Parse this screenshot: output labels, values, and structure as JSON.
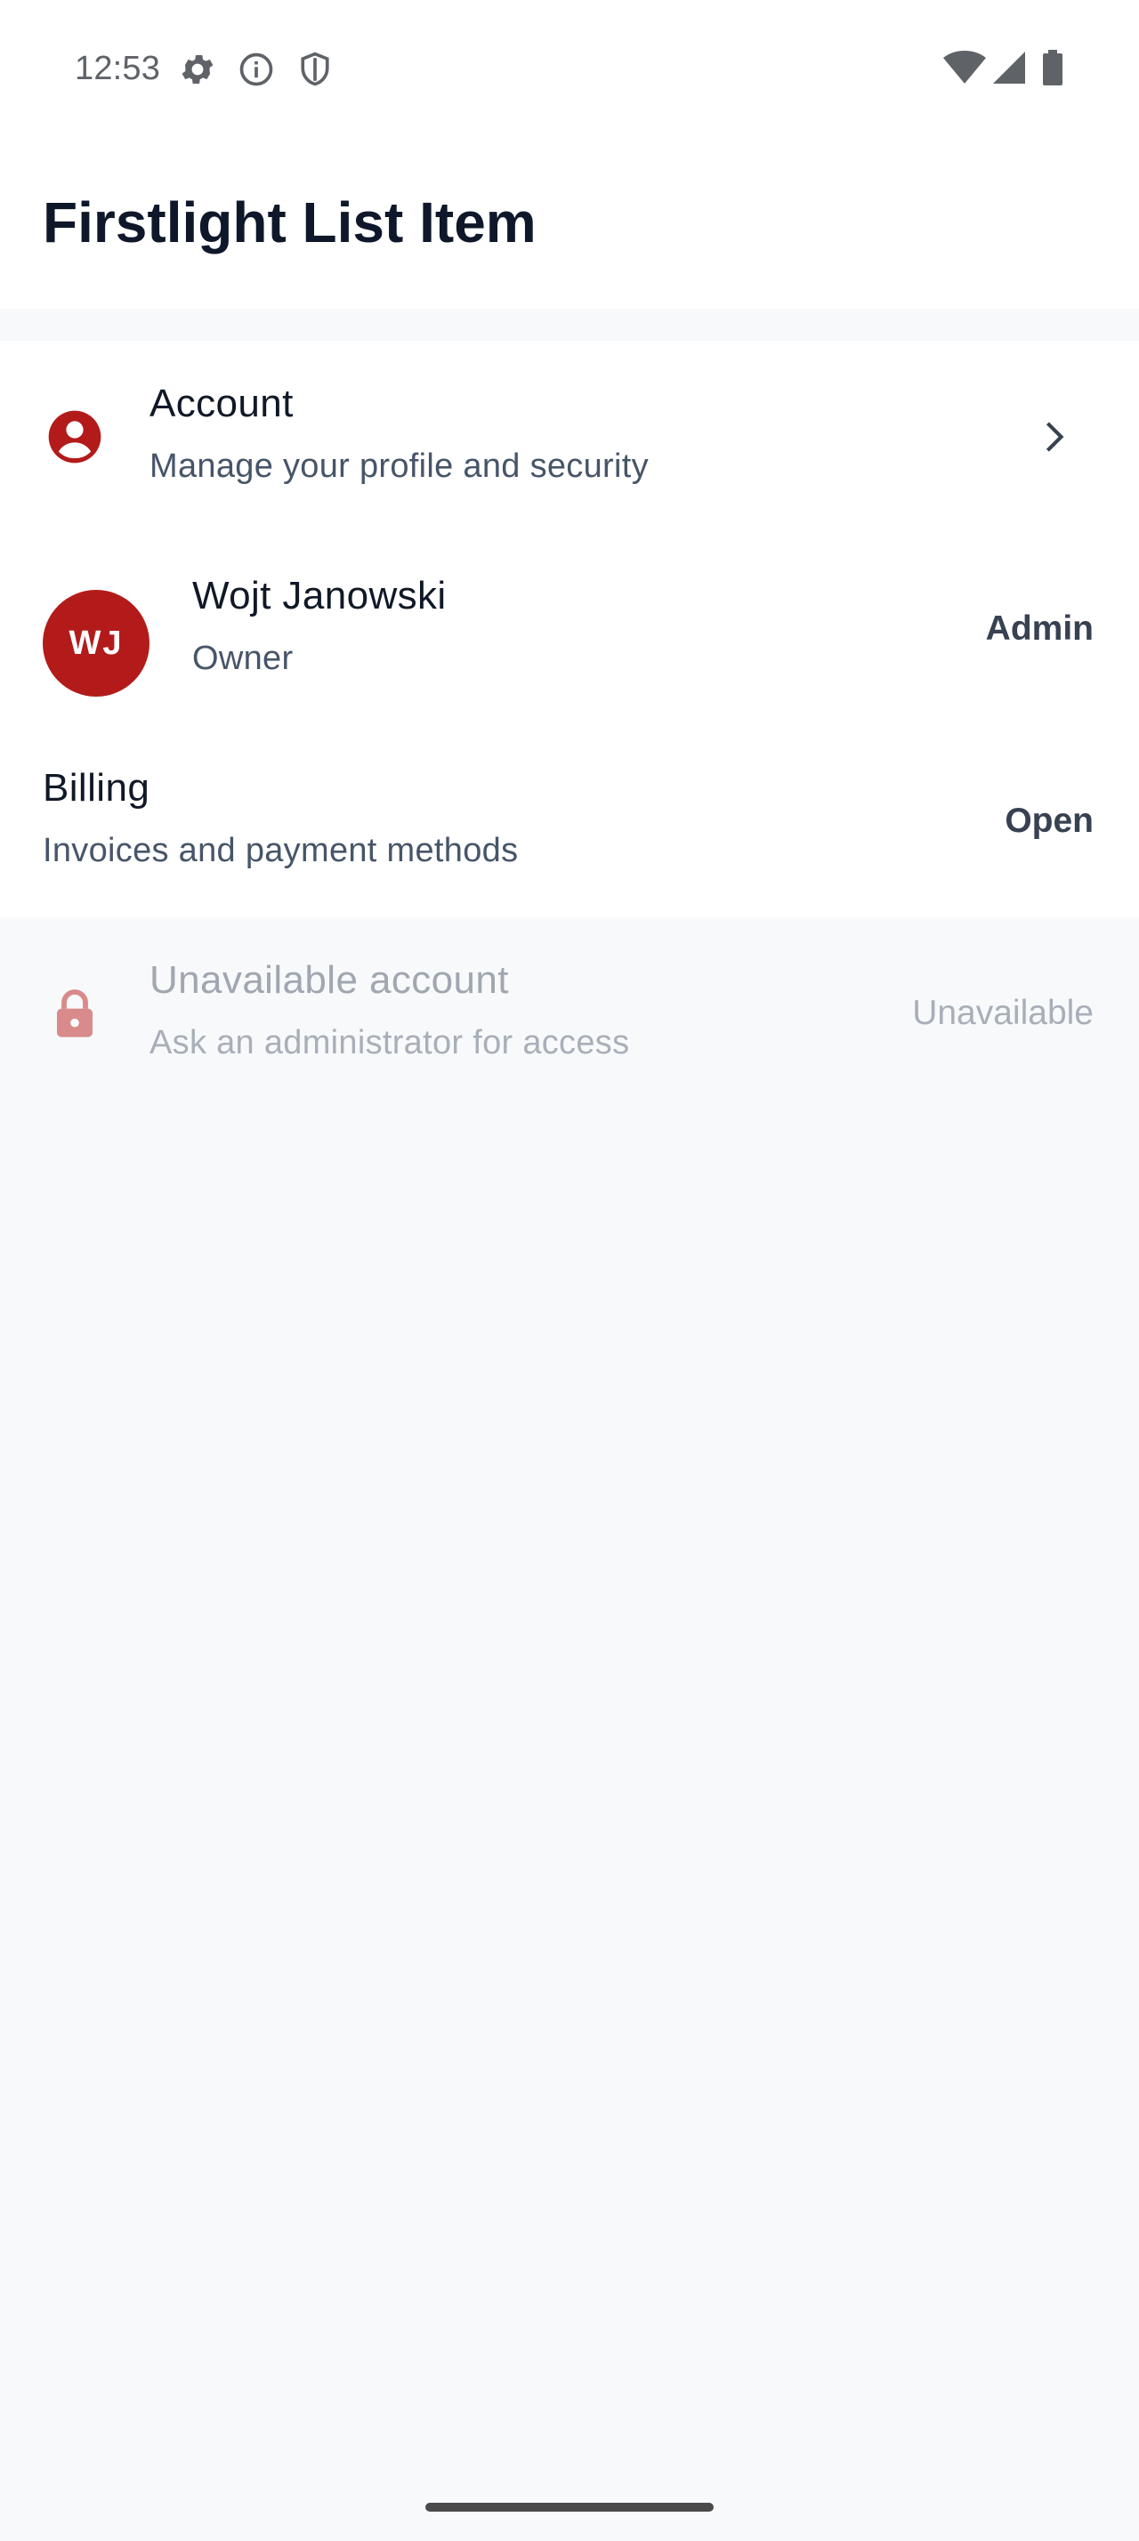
{
  "status_bar": {
    "time": "12:53",
    "left_icons": [
      "settings-gear-icon",
      "info-icon",
      "shield-icon"
    ],
    "right_icons": [
      "wifi-icon",
      "cell-signal-icon",
      "battery-icon"
    ]
  },
  "header": {
    "title": "Firstlight List Item"
  },
  "list": {
    "items": [
      {
        "title": "Account",
        "subtitle": "Manage your profile and security",
        "leading_icon": "account-circle-icon",
        "trailing_icon": "chevron-right-icon"
      },
      {
        "avatar_initials": "WJ",
        "title": "Wojt Janowski",
        "subtitle": "Owner",
        "trailing_text": "Admin"
      },
      {
        "title": "Billing",
        "subtitle": "Invoices and payment methods",
        "trailing_text": "Open"
      },
      {
        "title": "Unavailable account",
        "subtitle": "Ask an administrator for access",
        "leading_icon": "lock-icon",
        "trailing_text": "Unavailable",
        "disabled": true
      }
    ]
  },
  "colors": {
    "accent": "#B31B1B",
    "page_background": "#F8F9FB",
    "surface": "#FFFFFF",
    "title_text": "#0F172A",
    "secondary_text": "#475569"
  }
}
